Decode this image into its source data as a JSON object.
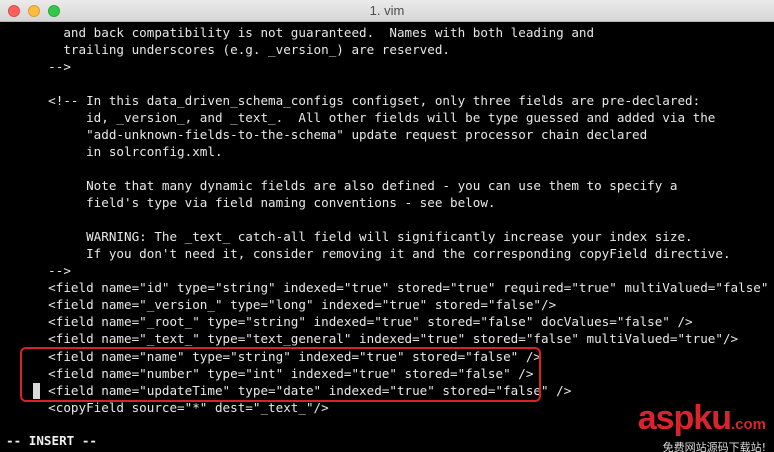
{
  "window": {
    "title": "1. vim"
  },
  "editor": {
    "lines": [
      "    and back compatibility is not guaranteed.  Names with both leading and",
      "    trailing underscores (e.g. _version_) are reserved.",
      "  -->",
      "",
      "  <!-- In this data_driven_schema_configs configset, only three fields are pre-declared:",
      "       id, _version_, and _text_.  All other fields will be type guessed and added via the",
      "       \"add-unknown-fields-to-the-schema\" update request processor chain declared",
      "       in solrconfig.xml.",
      "",
      "       Note that many dynamic fields are also defined - you can use them to specify a",
      "       field's type via field naming conventions - see below.",
      "",
      "       WARNING: The _text_ catch-all field will significantly increase your index size.",
      "       If you don't need it, consider removing it and the corresponding copyField directive.",
      "  -->",
      "  <field name=\"id\" type=\"string\" indexed=\"true\" stored=\"true\" required=\"true\" multiValued=\"false\" />",
      "  <field name=\"_version_\" type=\"long\" indexed=\"true\" stored=\"false\"/>",
      "  <field name=\"_root_\" type=\"string\" indexed=\"true\" stored=\"false\" docValues=\"false\" />",
      "  <field name=\"_text_\" type=\"text_general\" indexed=\"true\" stored=\"false\" multiValued=\"true\"/>",
      "  <field name=\"name\" type=\"string\" indexed=\"true\" stored=\"false\" />",
      "  <field name=\"number\" type=\"int\" indexed=\"true\" stored=\"false\" />",
      "  <field name=\"updateTime\" type=\"date\" indexed=\"true\" stored=\"false\" />",
      "  <copyField source=\"*\" dest=\"_text_\"/>"
    ],
    "mode": "-- INSERT --"
  },
  "watermark": {
    "brand_part1": "asp",
    "brand_part2": "ku",
    "brand_suffix": ".com",
    "tagline": "免费网站源码下载站!"
  },
  "colors": {
    "highlight": "#d92128",
    "brand": "#d9232d"
  }
}
